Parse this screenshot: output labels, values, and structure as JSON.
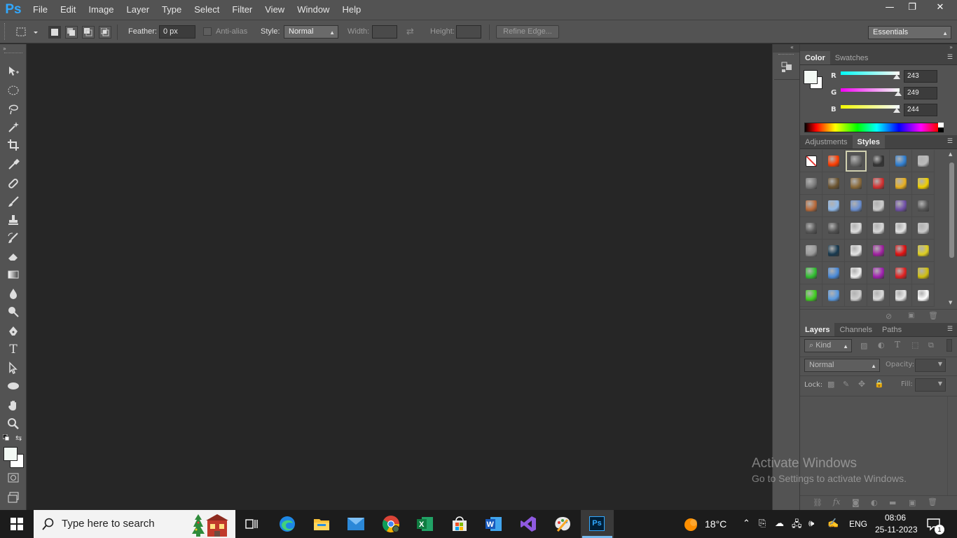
{
  "app": {
    "logo": "Ps"
  },
  "menubar": {
    "items": [
      "File",
      "Edit",
      "Image",
      "Layer",
      "Type",
      "Select",
      "Filter",
      "View",
      "Window",
      "Help"
    ]
  },
  "window_controls": {
    "minimize": "—",
    "restore": "❐",
    "close": "✕"
  },
  "options_bar": {
    "feather_label": "Feather:",
    "feather_value": "0 px",
    "antialias_label": "Anti-alias",
    "style_label": "Style:",
    "style_value": "Normal",
    "width_label": "Width:",
    "height_label": "Height:",
    "refine_edge_label": "Refine Edge...",
    "workspace_value": "Essentials"
  },
  "toolbox": {
    "tools": [
      "move-icon",
      "ellipse-marquee-icon",
      "lasso-icon",
      "magic-wand-icon",
      "crop-icon",
      "eyedropper-icon",
      "healing-brush-icon",
      "brush-icon",
      "clone-stamp-icon",
      "history-brush-icon",
      "eraser-icon",
      "gradient-icon",
      "blur-icon",
      "dodge-icon",
      "pen-icon",
      "type-icon",
      "path-selection-icon",
      "ellipse-shape-icon",
      "hand-icon",
      "zoom-icon"
    ],
    "type_glyph": "T"
  },
  "color_panel": {
    "tabs": [
      "Color",
      "Swatches"
    ],
    "active_tab": "Color",
    "channels": [
      {
        "label": "R",
        "value": "243",
        "fraction": 0.953
      },
      {
        "label": "G",
        "value": "249",
        "fraction": 0.976
      },
      {
        "label": "B",
        "value": "244",
        "fraction": 0.957
      }
    ],
    "foreground_color": "#f3f9f4"
  },
  "styles_panel": {
    "tabs": [
      "Adjustments",
      "Styles"
    ],
    "active_tab": "Styles",
    "swatch_colors": [
      "#ffffff",
      "#ff3d00",
      "#6b6b6b",
      "#333333",
      "#2f7fd1",
      "#bbbbbb",
      "#7a7a7a",
      "#6b5430",
      "#8a6a3a",
      "#d43030",
      "#e8b020",
      "#f0d000",
      "#b86a3a",
      "#8fb8e8",
      "#6a8fd0",
      "#cccccc",
      "#7050a8",
      "#555555",
      "#555555",
      "#505050",
      "#dddddd",
      "#d8d8d8",
      "#e2e2e2",
      "#c8c8c8",
      "#9a9a9a",
      "#17394f",
      "#e5e5e5",
      "#a020a0",
      "#e01010",
      "#e0d020",
      "#30c030",
      "#4a8ad8",
      "#eeeeee",
      "#a020b0",
      "#e02020",
      "#d0c010",
      "#40d020",
      "#5a9ae0",
      "#cfcfcf",
      "#dadada",
      "#e6e6e6",
      "#ffffff"
    ]
  },
  "layers_panel": {
    "tabs": [
      "Layers",
      "Channels",
      "Paths"
    ],
    "active_tab": "Layers",
    "kind_label": "Kind",
    "blend_mode": "Normal",
    "opacity_label": "Opacity:",
    "lock_label": "Lock:",
    "fill_label": "Fill:"
  },
  "watermark": {
    "line1": "Activate Windows",
    "line2": "Go to Settings to activate Windows."
  },
  "taskbar": {
    "search_placeholder": "Type here to search",
    "weather_temp": "18°C",
    "language": "ENG",
    "time": "08:06",
    "date": "25-11-2023",
    "notification_count": "1"
  }
}
